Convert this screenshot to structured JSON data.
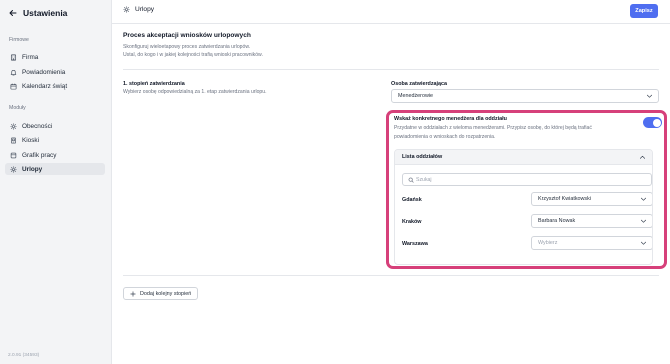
{
  "sidebar": {
    "title": "Ustawienia",
    "sections": [
      {
        "label": "Firmowe"
      },
      {
        "label": "Moduły"
      }
    ],
    "items": [
      {
        "label": "Firma",
        "icon": "building-icon"
      },
      {
        "label": "Powiadomienia",
        "icon": "bell-icon"
      },
      {
        "label": "Kalendarz świąt",
        "icon": "calendar-icon"
      },
      {
        "label": "Obecności",
        "icon": "gear-icon"
      },
      {
        "label": "Kioski",
        "icon": "kiosk-icon"
      },
      {
        "label": "Grafik pracy",
        "icon": "schedule-icon"
      },
      {
        "label": "Urlopy",
        "icon": "gear-icon",
        "active": true
      }
    ],
    "version": "2.0.91 (34593)"
  },
  "header": {
    "title": "Urlopy",
    "save_label": "Zapisz"
  },
  "main": {
    "title": "Proces akceptacji wniosków urlopowych",
    "desc_line1": "Skonfiguruj wieloetapowy proces zatwierdzania urlopów.",
    "desc_line2": "Ustal, do kogo i w jakiej kolejności trafią wnioski pracowników.",
    "step": {
      "title": "1. stopień zatwierdzania",
      "desc": "Wybierz osobę odpowiedzialną za 1. etap zatwierdzania urlopu."
    },
    "approver": {
      "label": "Osoba zatwierdzająca",
      "value": "Menedżerowie"
    },
    "panel": {
      "title": "Wskaż konkretnego menedżera dla oddziału",
      "desc_line1": "Przydatne w oddziałach z wieloma menedżerami. Przypisz osobę, do której będą trafiać",
      "desc_line2": "powiadomienia o wnioskach do rozpatrzenia.",
      "toggle_on": true,
      "list_title": "Lista oddziałów",
      "search_placeholder": "Szukaj",
      "departments": [
        {
          "name": "Gdańsk",
          "manager": "Krzysztof Kwiatkowski"
        },
        {
          "name": "Kraków",
          "manager": "Barbara Nowak"
        },
        {
          "name": "Warszawa",
          "manager": "Wybierz"
        }
      ]
    },
    "add_step_label": "Dodaj kolejny stopień"
  },
  "colors": {
    "accent": "#4f6ef0",
    "highlight": "#d6407a",
    "sidebar_bg": "#f3f4f6"
  }
}
